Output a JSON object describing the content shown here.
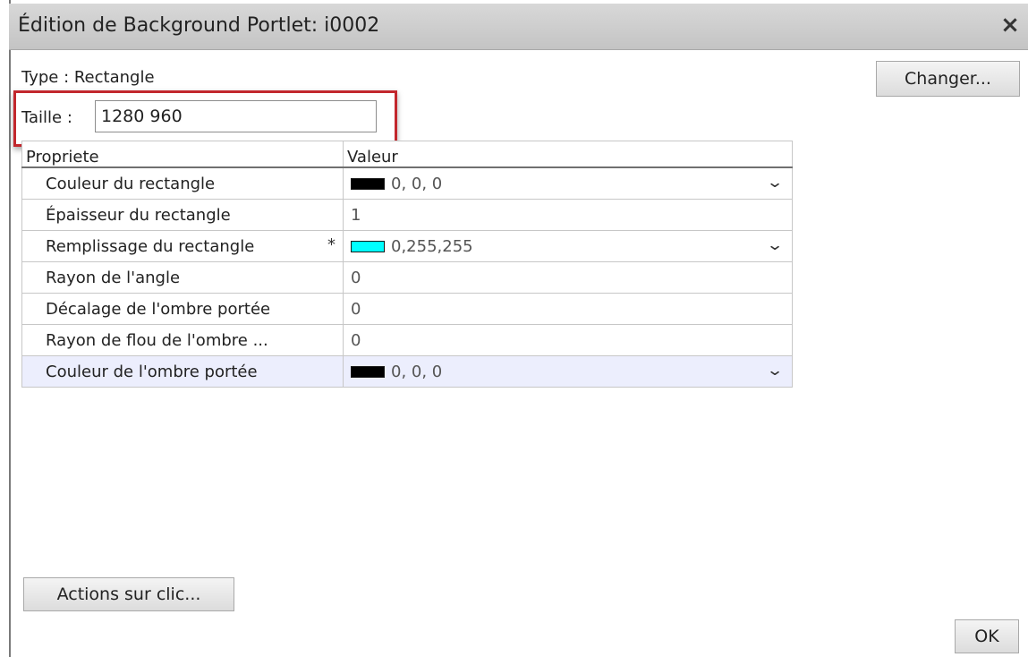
{
  "dialog": {
    "title": "Édition de Background Portlet: i0002",
    "close": "×"
  },
  "type_label": "Type : Rectangle",
  "change_button": "Changer...",
  "size": {
    "label": "Taille :",
    "value": "1280 960"
  },
  "grid": {
    "headers": [
      "Propriete",
      "Valeur"
    ],
    "rows": [
      {
        "property": "Couleur du rectangle",
        "value": "0, 0, 0",
        "swatch": "#000000",
        "dropdown": true
      },
      {
        "property": "Épaisseur du rectangle",
        "value": "1"
      },
      {
        "property": "Remplissage du rectangle",
        "required": "*",
        "value": "0,255,255",
        "swatch": "#00ffff",
        "dropdown": true
      },
      {
        "property": "Rayon de l'angle",
        "value": "0"
      },
      {
        "property": "Décalage de l'ombre portée",
        "value": "0"
      },
      {
        "property": "Rayon de flou de l'ombre ...",
        "value": "0"
      },
      {
        "property": "Couleur de l'ombre portée",
        "value": "0, 0, 0",
        "swatch": "#000000",
        "dropdown": true,
        "selected": true
      }
    ]
  },
  "actions_button": "Actions sur clic...",
  "ok_button": "OK",
  "colors": {
    "highlight": "#c2272d",
    "selected_row": "#eceefd",
    "title_bar": "#c4c4c4"
  }
}
